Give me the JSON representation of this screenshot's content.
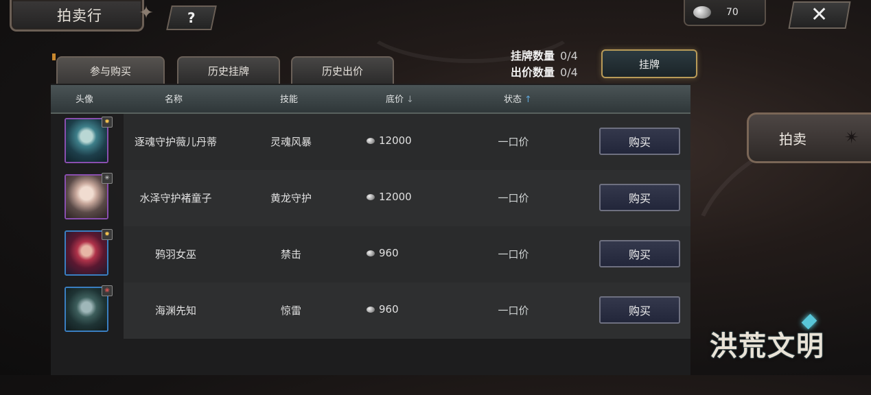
{
  "header": {
    "title": "拍卖行",
    "help_label": "?",
    "currency_value": "70",
    "close_label": "✕"
  },
  "tabs": [
    {
      "label": "参与购买",
      "active": true
    },
    {
      "label": "历史挂牌",
      "active": false
    },
    {
      "label": "历史出价",
      "active": false
    }
  ],
  "counters": {
    "listing_label": "挂牌数量",
    "listing_value": "0/4",
    "bid_label": "出价数量",
    "bid_value": "0/4",
    "list_button": "挂牌"
  },
  "table": {
    "columns": [
      "头像",
      "名称",
      "技能",
      "底价",
      "状态"
    ],
    "rows": [
      {
        "name": "逐魂守护薇儿丹蒂",
        "skill": "灵魂风暴",
        "price": "12000",
        "status": "一口价",
        "buy": "购买",
        "avatar_border": "purple"
      },
      {
        "name": "水泽守护褚童子",
        "skill": "黄龙守护",
        "price": "12000",
        "status": "一口价",
        "buy": "购买",
        "avatar_border": "purple"
      },
      {
        "name": "鸦羽女巫",
        "skill": "禁击",
        "price": "960",
        "status": "一口价",
        "buy": "购买",
        "avatar_border": "blue"
      },
      {
        "name": "海渊先知",
        "skill": "惊雷",
        "price": "960",
        "status": "一口价",
        "buy": "购买",
        "avatar_border": "blue"
      }
    ]
  },
  "side": {
    "auction_button": "拍卖"
  },
  "logo": {
    "text": "洪荒文明"
  },
  "colors": {
    "accent_gold": "#b99b58",
    "purple_frame": "#8a4fb0",
    "blue_frame": "#3a7fc2",
    "sort_up": "#5fa5d8"
  }
}
